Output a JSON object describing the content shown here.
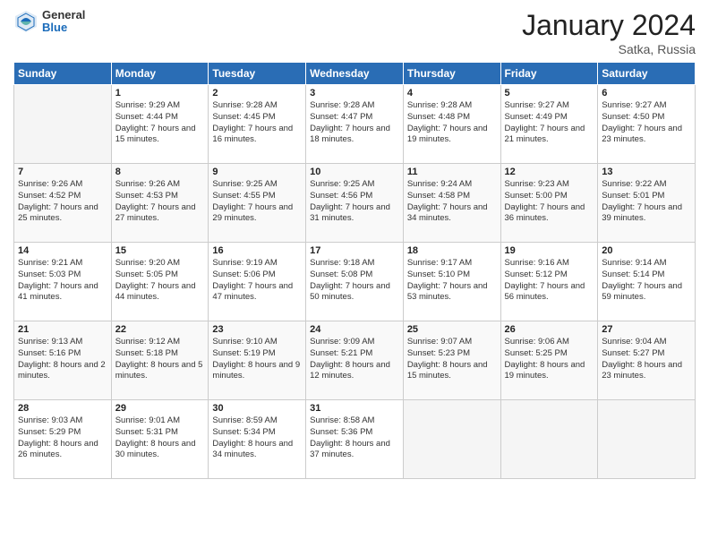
{
  "logo": {
    "general": "General",
    "blue": "Blue"
  },
  "title": "January 2024",
  "location": "Satka, Russia",
  "days_of_week": [
    "Sunday",
    "Monday",
    "Tuesday",
    "Wednesday",
    "Thursday",
    "Friday",
    "Saturday"
  ],
  "weeks": [
    [
      {
        "day": "",
        "empty": true
      },
      {
        "day": "1",
        "sunrise": "Sunrise: 9:29 AM",
        "sunset": "Sunset: 4:44 PM",
        "daylight": "Daylight: 7 hours and 15 minutes."
      },
      {
        "day": "2",
        "sunrise": "Sunrise: 9:28 AM",
        "sunset": "Sunset: 4:45 PM",
        "daylight": "Daylight: 7 hours and 16 minutes."
      },
      {
        "day": "3",
        "sunrise": "Sunrise: 9:28 AM",
        "sunset": "Sunset: 4:47 PM",
        "daylight": "Daylight: 7 hours and 18 minutes."
      },
      {
        "day": "4",
        "sunrise": "Sunrise: 9:28 AM",
        "sunset": "Sunset: 4:48 PM",
        "daylight": "Daylight: 7 hours and 19 minutes."
      },
      {
        "day": "5",
        "sunrise": "Sunrise: 9:27 AM",
        "sunset": "Sunset: 4:49 PM",
        "daylight": "Daylight: 7 hours and 21 minutes."
      },
      {
        "day": "6",
        "sunrise": "Sunrise: 9:27 AM",
        "sunset": "Sunset: 4:50 PM",
        "daylight": "Daylight: 7 hours and 23 minutes."
      }
    ],
    [
      {
        "day": "7",
        "sunrise": "Sunrise: 9:26 AM",
        "sunset": "Sunset: 4:52 PM",
        "daylight": "Daylight: 7 hours and 25 minutes."
      },
      {
        "day": "8",
        "sunrise": "Sunrise: 9:26 AM",
        "sunset": "Sunset: 4:53 PM",
        "daylight": "Daylight: 7 hours and 27 minutes."
      },
      {
        "day": "9",
        "sunrise": "Sunrise: 9:25 AM",
        "sunset": "Sunset: 4:55 PM",
        "daylight": "Daylight: 7 hours and 29 minutes."
      },
      {
        "day": "10",
        "sunrise": "Sunrise: 9:25 AM",
        "sunset": "Sunset: 4:56 PM",
        "daylight": "Daylight: 7 hours and 31 minutes."
      },
      {
        "day": "11",
        "sunrise": "Sunrise: 9:24 AM",
        "sunset": "Sunset: 4:58 PM",
        "daylight": "Daylight: 7 hours and 34 minutes."
      },
      {
        "day": "12",
        "sunrise": "Sunrise: 9:23 AM",
        "sunset": "Sunset: 5:00 PM",
        "daylight": "Daylight: 7 hours and 36 minutes."
      },
      {
        "day": "13",
        "sunrise": "Sunrise: 9:22 AM",
        "sunset": "Sunset: 5:01 PM",
        "daylight": "Daylight: 7 hours and 39 minutes."
      }
    ],
    [
      {
        "day": "14",
        "sunrise": "Sunrise: 9:21 AM",
        "sunset": "Sunset: 5:03 PM",
        "daylight": "Daylight: 7 hours and 41 minutes."
      },
      {
        "day": "15",
        "sunrise": "Sunrise: 9:20 AM",
        "sunset": "Sunset: 5:05 PM",
        "daylight": "Daylight: 7 hours and 44 minutes."
      },
      {
        "day": "16",
        "sunrise": "Sunrise: 9:19 AM",
        "sunset": "Sunset: 5:06 PM",
        "daylight": "Daylight: 7 hours and 47 minutes."
      },
      {
        "day": "17",
        "sunrise": "Sunrise: 9:18 AM",
        "sunset": "Sunset: 5:08 PM",
        "daylight": "Daylight: 7 hours and 50 minutes."
      },
      {
        "day": "18",
        "sunrise": "Sunrise: 9:17 AM",
        "sunset": "Sunset: 5:10 PM",
        "daylight": "Daylight: 7 hours and 53 minutes."
      },
      {
        "day": "19",
        "sunrise": "Sunrise: 9:16 AM",
        "sunset": "Sunset: 5:12 PM",
        "daylight": "Daylight: 7 hours and 56 minutes."
      },
      {
        "day": "20",
        "sunrise": "Sunrise: 9:14 AM",
        "sunset": "Sunset: 5:14 PM",
        "daylight": "Daylight: 7 hours and 59 minutes."
      }
    ],
    [
      {
        "day": "21",
        "sunrise": "Sunrise: 9:13 AM",
        "sunset": "Sunset: 5:16 PM",
        "daylight": "Daylight: 8 hours and 2 minutes."
      },
      {
        "day": "22",
        "sunrise": "Sunrise: 9:12 AM",
        "sunset": "Sunset: 5:18 PM",
        "daylight": "Daylight: 8 hours and 5 minutes."
      },
      {
        "day": "23",
        "sunrise": "Sunrise: 9:10 AM",
        "sunset": "Sunset: 5:19 PM",
        "daylight": "Daylight: 8 hours and 9 minutes."
      },
      {
        "day": "24",
        "sunrise": "Sunrise: 9:09 AM",
        "sunset": "Sunset: 5:21 PM",
        "daylight": "Daylight: 8 hours and 12 minutes."
      },
      {
        "day": "25",
        "sunrise": "Sunrise: 9:07 AM",
        "sunset": "Sunset: 5:23 PM",
        "daylight": "Daylight: 8 hours and 15 minutes."
      },
      {
        "day": "26",
        "sunrise": "Sunrise: 9:06 AM",
        "sunset": "Sunset: 5:25 PM",
        "daylight": "Daylight: 8 hours and 19 minutes."
      },
      {
        "day": "27",
        "sunrise": "Sunrise: 9:04 AM",
        "sunset": "Sunset: 5:27 PM",
        "daylight": "Daylight: 8 hours and 23 minutes."
      }
    ],
    [
      {
        "day": "28",
        "sunrise": "Sunrise: 9:03 AM",
        "sunset": "Sunset: 5:29 PM",
        "daylight": "Daylight: 8 hours and 26 minutes."
      },
      {
        "day": "29",
        "sunrise": "Sunrise: 9:01 AM",
        "sunset": "Sunset: 5:31 PM",
        "daylight": "Daylight: 8 hours and 30 minutes."
      },
      {
        "day": "30",
        "sunrise": "Sunrise: 8:59 AM",
        "sunset": "Sunset: 5:34 PM",
        "daylight": "Daylight: 8 hours and 34 minutes."
      },
      {
        "day": "31",
        "sunrise": "Sunrise: 8:58 AM",
        "sunset": "Sunset: 5:36 PM",
        "daylight": "Daylight: 8 hours and 37 minutes."
      },
      {
        "day": "",
        "empty": true
      },
      {
        "day": "",
        "empty": true
      },
      {
        "day": "",
        "empty": true
      }
    ]
  ]
}
